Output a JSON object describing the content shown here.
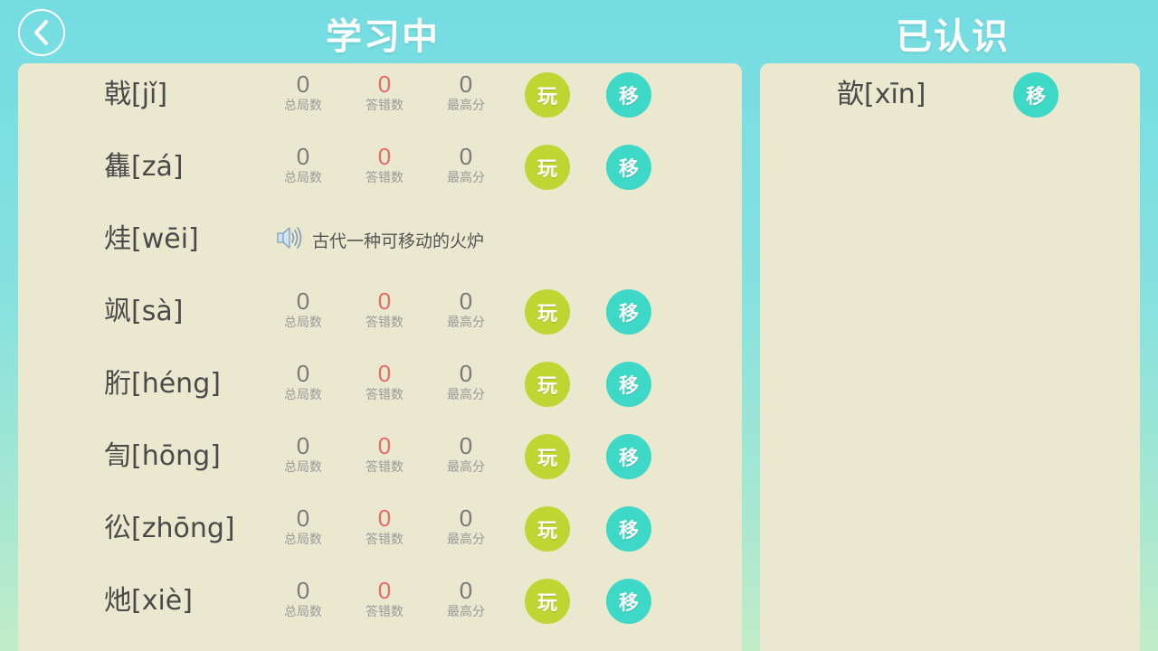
{
  "header": {
    "learning_title": "学习中",
    "known_title": "已认识"
  },
  "stat_labels": {
    "total": "总局数",
    "wrong": "答错数",
    "best": "最高分"
  },
  "buttons": {
    "play": "玩",
    "move": "移"
  },
  "learning_list": [
    {
      "word": "戟[jǐ]",
      "total": "0",
      "wrong": "0",
      "best": "0"
    },
    {
      "word": "雥[zá]",
      "total": "0",
      "wrong": "0",
      "best": "0"
    },
    {
      "word": "烓[wēi]",
      "definition": "古代一种可移动的火炉"
    },
    {
      "word": "飒[sà]",
      "total": "0",
      "wrong": "0",
      "best": "0"
    },
    {
      "word": "胻[héng]",
      "total": "0",
      "wrong": "0",
      "best": "0"
    },
    {
      "word": "訇[hōng]",
      "total": "0",
      "wrong": "0",
      "best": "0"
    },
    {
      "word": "彸[zhōng]",
      "total": "0",
      "wrong": "0",
      "best": "0"
    },
    {
      "word": "灺[xiè]",
      "total": "0",
      "wrong": "0",
      "best": "0"
    }
  ],
  "known_list": [
    {
      "word": "歆[xīn]"
    }
  ],
  "colors": {
    "play_button": "#bed632",
    "move_button": "#3ed8c6",
    "wrong_count": "#e86a6a",
    "panel": "#ebe8d0"
  },
  "icons": [
    "back-arrow-icon",
    "speaker-icon"
  ]
}
